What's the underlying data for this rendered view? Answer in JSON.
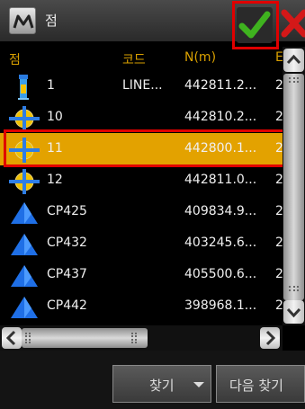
{
  "window": {
    "title": "점",
    "app_icon": "m-logo-icon",
    "ok_icon": "check-icon",
    "close_icon": "close-icon"
  },
  "table": {
    "columns": [
      "점",
      "코드",
      "N(m)",
      "E"
    ],
    "rows": [
      {
        "name": "1",
        "code": "LINE...",
        "n": "442811.2...",
        "extra": "2",
        "icon": "instrument-station-icon",
        "selected": false
      },
      {
        "name": "10",
        "code": "",
        "n": "442810.2...",
        "extra": "2",
        "icon": "point-target-icon",
        "selected": false
      },
      {
        "name": "11",
        "code": "",
        "n": "442800.1...",
        "extra": "2",
        "icon": "point-target-icon",
        "selected": true
      },
      {
        "name": "12",
        "code": "",
        "n": "442811.0...",
        "extra": "2",
        "icon": "point-target-icon",
        "selected": false
      },
      {
        "name": "CP425",
        "code": "",
        "n": "409834.9...",
        "extra": "2",
        "icon": "control-point-triangle-icon",
        "selected": false
      },
      {
        "name": "CP432",
        "code": "",
        "n": "403245.6...",
        "extra": "2",
        "icon": "control-point-triangle-icon",
        "selected": false
      },
      {
        "name": "CP437",
        "code": "",
        "n": "405500.6...",
        "extra": "2",
        "icon": "control-point-triangle-icon",
        "selected": false
      },
      {
        "name": "CP442",
        "code": "",
        "n": "398968.1...",
        "extra": "2",
        "icon": "control-point-triangle-icon",
        "selected": false
      }
    ]
  },
  "bottom": {
    "find_label": "찾기",
    "find_next_label": "다음 찾기"
  },
  "colors": {
    "header_text": "#d9a000",
    "selection": "#e3a200",
    "highlight_box": "#e00000",
    "check_green": "#3fb31f",
    "triangle_blue": "#1f6fe6"
  }
}
